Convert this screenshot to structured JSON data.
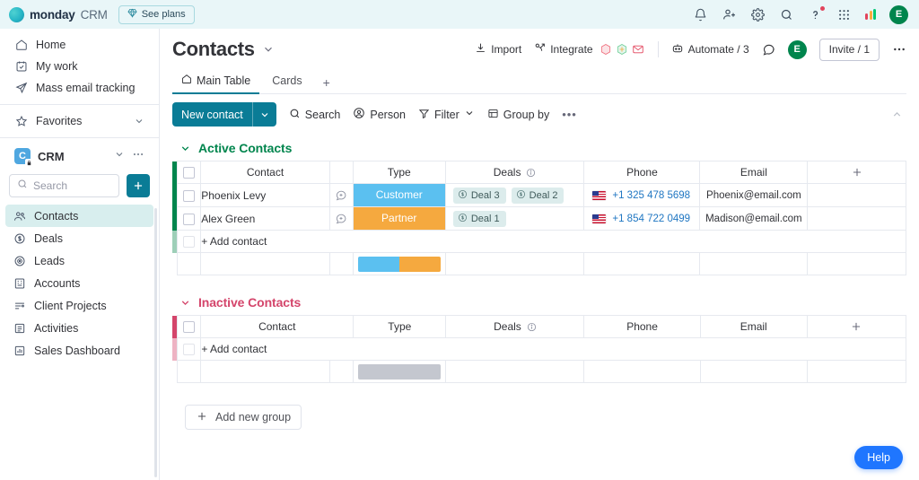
{
  "topbar": {
    "brand_name": "monday",
    "brand_product": "CRM",
    "see_plans": "See plans",
    "icons": [
      "bell-icon",
      "invite-member-icon",
      "gear-icon",
      "search-icon",
      "help-icon",
      "apps-grid-icon",
      "monday-logo-icon"
    ],
    "avatar_initial": "E",
    "notification_color": "#e2445c"
  },
  "sidebar": {
    "nav": [
      {
        "label": "Home",
        "icon": "home-icon"
      },
      {
        "label": "My work",
        "icon": "my-work-icon"
      },
      {
        "label": "Mass email tracking",
        "icon": "paper-plane-icon"
      }
    ],
    "favorites": {
      "label": "Favorites",
      "icon": "star-icon"
    },
    "workspace": {
      "name": "CRM",
      "initial": "C",
      "icon_color": "#4fa7e0"
    },
    "search": {
      "placeholder": "Search",
      "value": ""
    },
    "add_button": "+",
    "boards": [
      {
        "label": "Contacts",
        "icon": "contacts-icon",
        "active": true
      },
      {
        "label": "Deals",
        "icon": "deals-icon",
        "active": false
      },
      {
        "label": "Leads",
        "icon": "leads-icon",
        "active": false
      },
      {
        "label": "Accounts",
        "icon": "accounts-icon",
        "active": false
      },
      {
        "label": "Client Projects",
        "icon": "client-projects-icon",
        "active": false
      },
      {
        "label": "Activities",
        "icon": "activities-icon",
        "active": false
      },
      {
        "label": "Sales Dashboard",
        "icon": "sales-dashboard-icon",
        "active": false
      }
    ]
  },
  "board": {
    "title": "Contacts",
    "actions": {
      "import": "Import",
      "integrate": "Integrate",
      "automate": "Automate / 3",
      "invite": "Invite / 1",
      "avatar_initial": "E"
    },
    "tabs": [
      {
        "label": "Main Table",
        "icon": "home-icon",
        "active": true
      },
      {
        "label": "Cards",
        "icon": "",
        "active": false
      }
    ],
    "tab_add": "+",
    "toolbar": {
      "new_contact": "New contact",
      "search": "Search",
      "person": "Person",
      "filter": "Filter",
      "group_by": "Group by",
      "more": "•••"
    }
  },
  "table": {
    "columns": [
      "Contact",
      "Type",
      "Deals",
      "Phone",
      "Email"
    ],
    "add_column": "+",
    "add_contact_label": "+ Add contact"
  },
  "groups": [
    {
      "name": "Active Contacts",
      "color": "#00854d",
      "rows": [
        {
          "contact": "Phoenix Levy",
          "type": "Customer",
          "type_color": "#5bc0f0",
          "deals": [
            "Deal 3",
            "Deal 2"
          ],
          "phone": "+1 325 478 5698",
          "email": "Phoenix@email.com"
        },
        {
          "contact": "Alex Green",
          "type": "Partner",
          "type_color": "#f5a93f",
          "deals": [
            "Deal 1"
          ],
          "phone": "+1 854 722 0499",
          "email": "Madison@email.com"
        }
      ],
      "summary": [
        {
          "color": "#5bc0f0",
          "pct": 50
        },
        {
          "color": "#f5a93f",
          "pct": 50
        }
      ]
    },
    {
      "name": "Inactive Contacts",
      "color": "#d4456b",
      "rows": [],
      "summary": [
        {
          "color": "#c4c7cf",
          "pct": 100
        }
      ]
    }
  ],
  "footer": {
    "add_new_group": "Add new group",
    "help": "Help"
  }
}
